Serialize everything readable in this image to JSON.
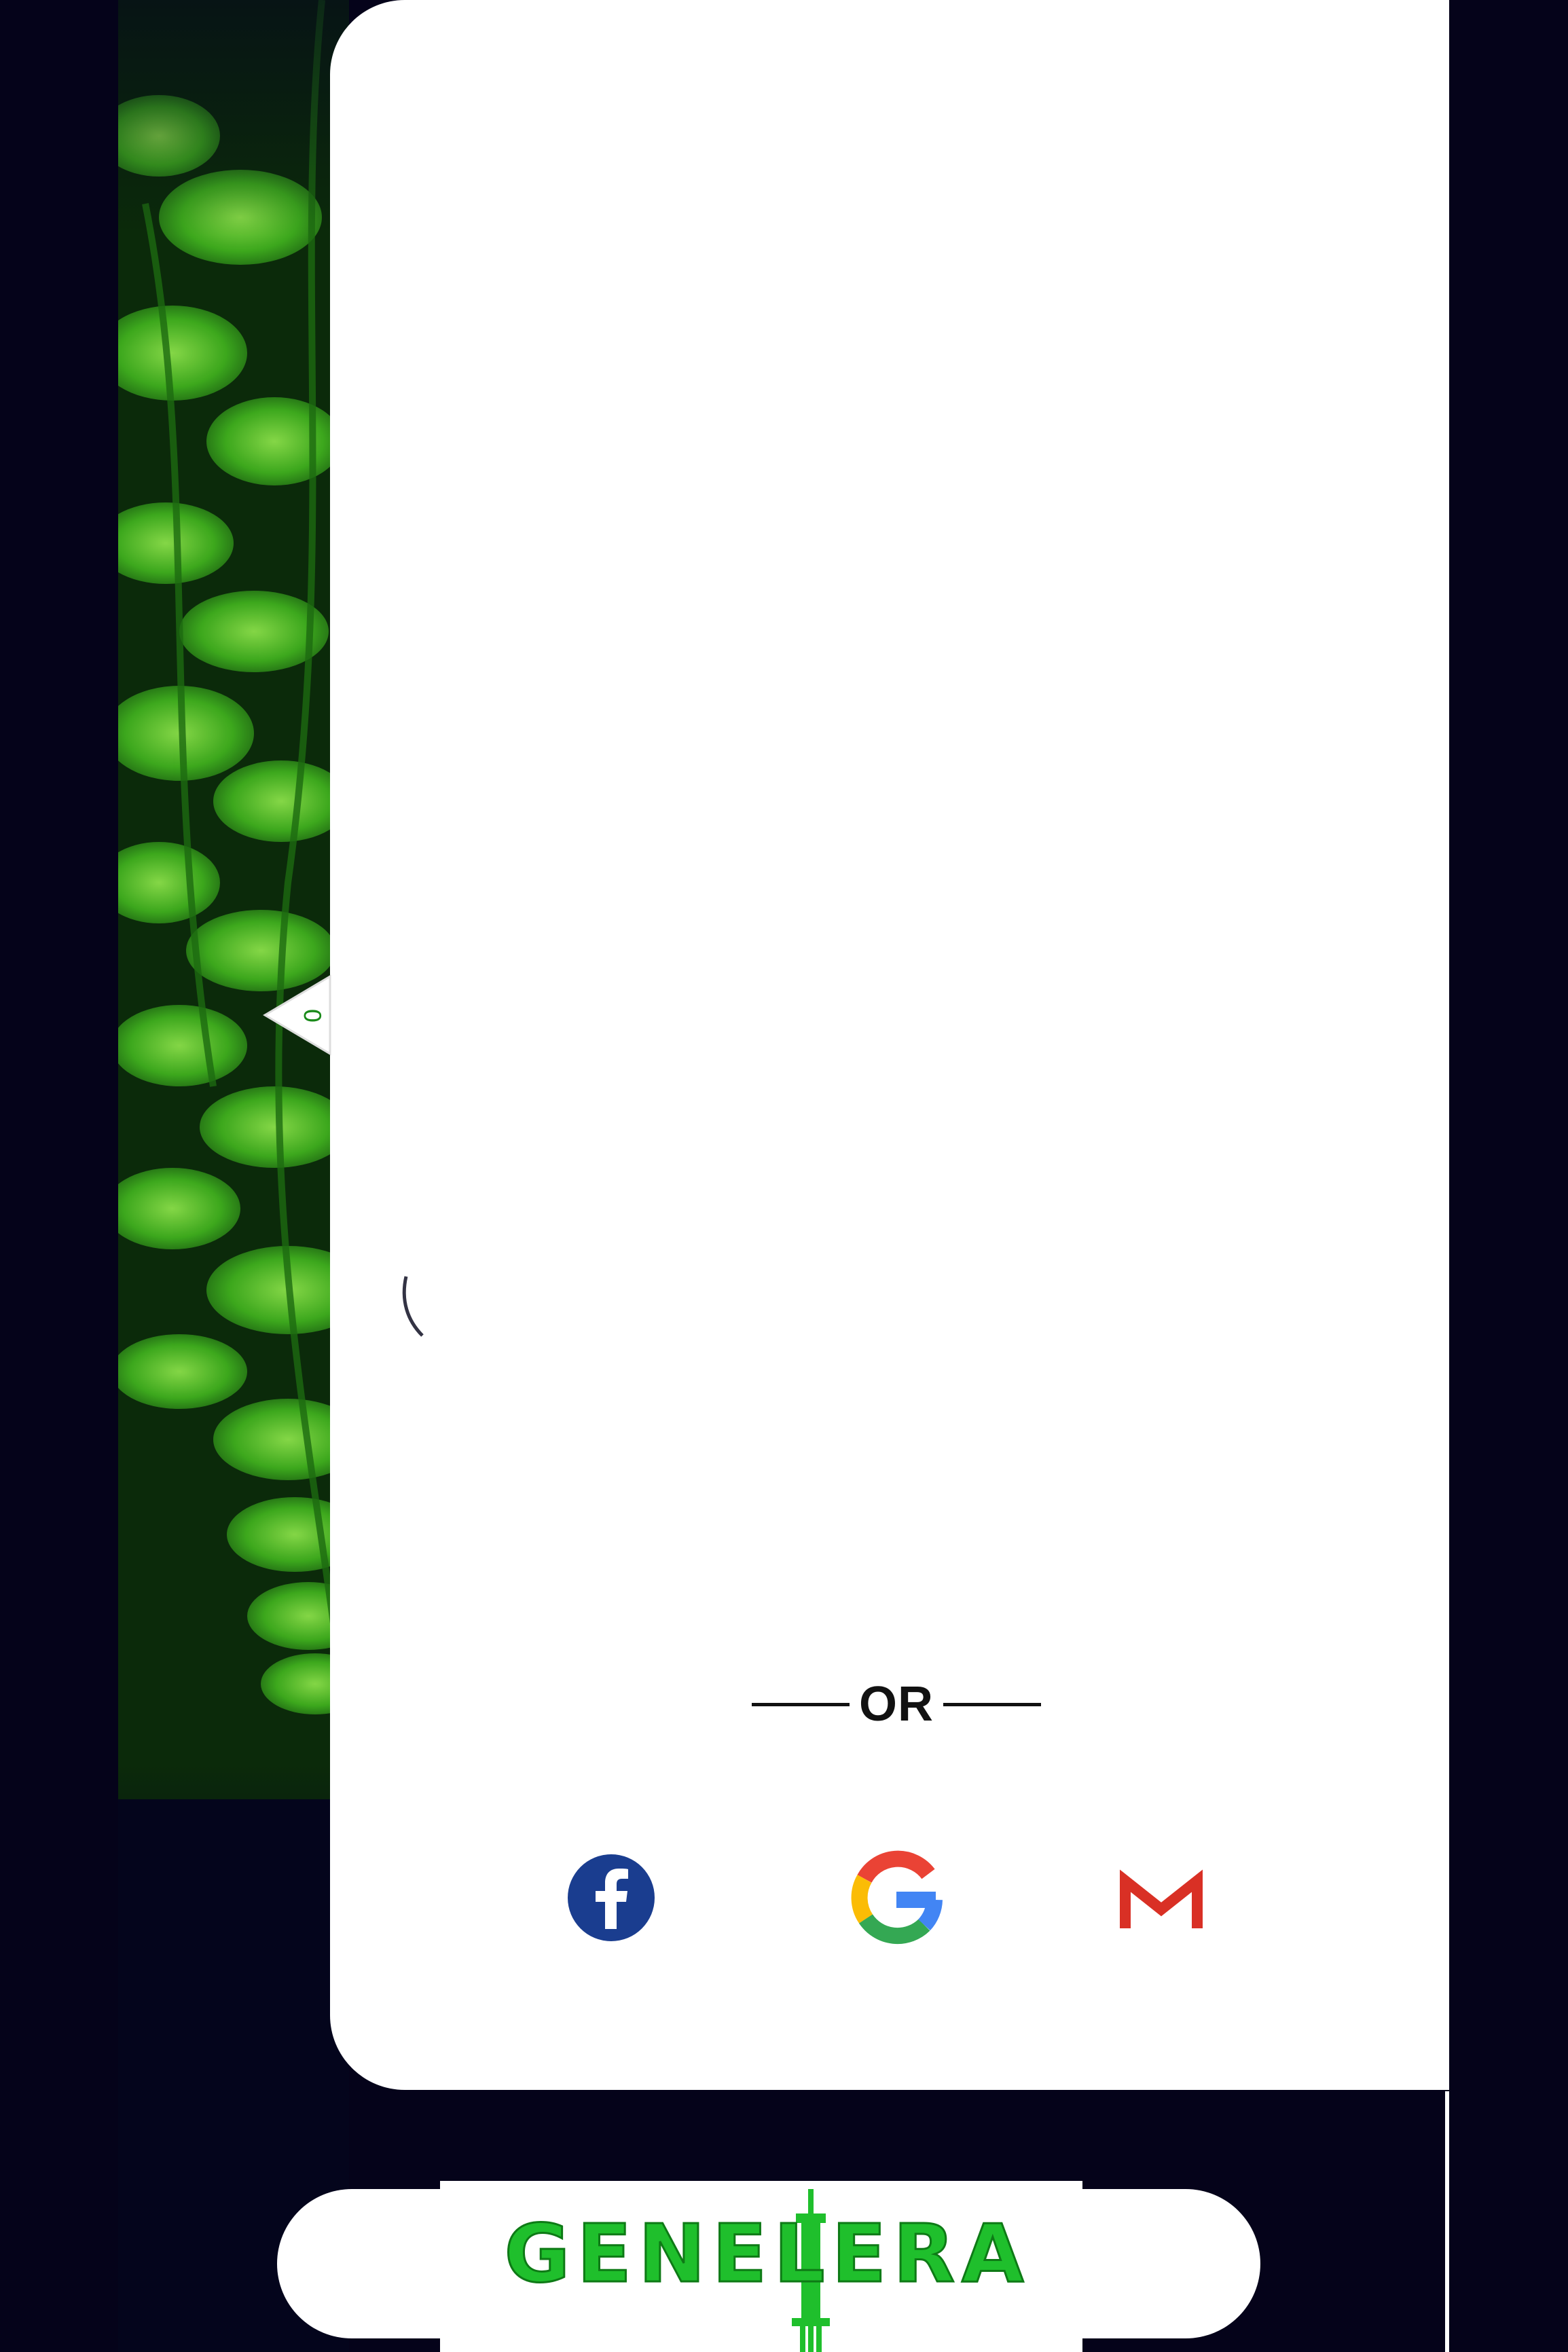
{
  "login_card": {
    "divider_text": "OR"
  },
  "social_login": {
    "buttons": [
      {
        "name": "facebook",
        "icon": "facebook-icon",
        "color": "#1a3d8f"
      },
      {
        "name": "google",
        "icon": "google-icon",
        "colors": [
          "#ea4335",
          "#fbbc05",
          "#34a853",
          "#4285f4"
        ]
      },
      {
        "name": "gmail",
        "icon": "gmail-icon",
        "color": "#d93025"
      }
    ]
  },
  "drawer_tab": {
    "icon": "chevron-left-icon",
    "label": "0"
  },
  "brand": {
    "logo_text": "GENELERA",
    "logo_color": "#1fbf2c",
    "icon": "syringe-icon"
  },
  "colors": {
    "background": "#05031a",
    "card": "#ffffff",
    "fern_green": "#3fbf22"
  }
}
